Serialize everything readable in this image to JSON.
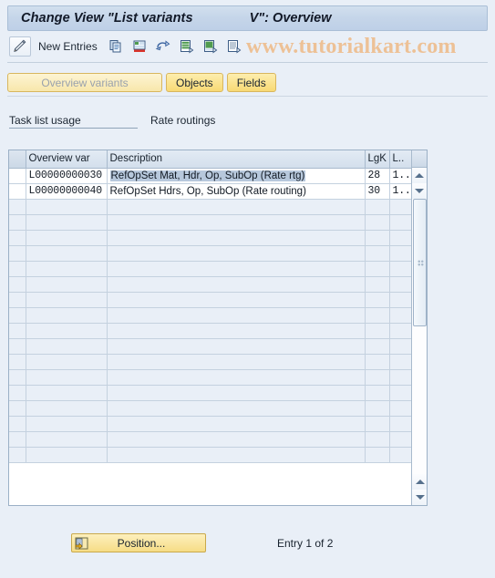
{
  "window": {
    "title_main": "Change View \"List variants",
    "title_tail": "V\": Overview"
  },
  "toolbar": {
    "pencil_icon": "pencil-display-change-icon",
    "new_entries_label": "New Entries",
    "icons": [
      {
        "name": "copy-icon"
      },
      {
        "name": "delete-row-icon"
      },
      {
        "name": "undo-icon"
      },
      {
        "name": "select-all-icon"
      },
      {
        "name": "select-block-icon"
      },
      {
        "name": "deselect-all-icon"
      }
    ],
    "watermark": "www.tutorialkart.com"
  },
  "tabs": [
    {
      "label": "Overview variants",
      "state": "active"
    },
    {
      "label": "Objects",
      "state": "normal"
    },
    {
      "label": "Fields",
      "state": "normal"
    }
  ],
  "field": {
    "label": "Task list usage",
    "value": "Rate routings"
  },
  "table": {
    "columns": [
      "Overview var",
      "Description",
      "LgK",
      "L.."
    ],
    "rows": [
      {
        "overview_var": "L00000000030",
        "description": "RefOpSet Mat, Hdr, Op, SubOp (Rate rtg)",
        "lgk": "28",
        "l2": "1...",
        "selected": true
      },
      {
        "overview_var": "L00000000040",
        "description": "RefOpSet Hdrs, Op, SubOp (Rate routing)",
        "lgk": "30",
        "l2": "1...",
        "selected": false
      }
    ],
    "empty_row_count": 16
  },
  "footer": {
    "position_button_label": "Position...",
    "position_button_icon": "position-jump-icon",
    "entry_status": "Entry 1 of 2"
  },
  "colors": {
    "window_bg": "#e9eff7",
    "title_bg": "#c5d5e9",
    "tab_active": "#f8e7ab",
    "tab_normal": "#f8d974",
    "row_highlight": "#b7c8dc",
    "watermark": "#edc196",
    "button_border": "#c9a94b"
  }
}
